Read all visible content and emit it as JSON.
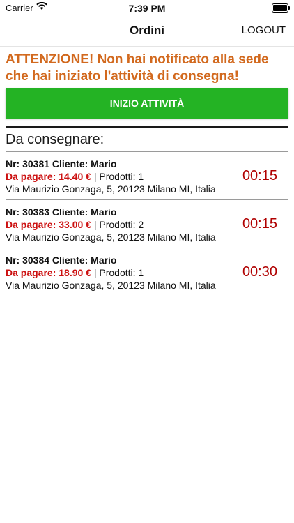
{
  "status_bar": {
    "carrier": "Carrier",
    "time": "7:39 PM"
  },
  "nav": {
    "title": "Ordini",
    "logout_label": "LOGOUT"
  },
  "warning": {
    "text": "ATTENZIONE! Non hai notificato alla sede che hai iniziato l'attività di consegna!",
    "color": "#d2691e"
  },
  "start_button": {
    "label": "INIZIO ATTIVITÀ",
    "color": "#24b324"
  },
  "section": {
    "title": "Da consegnare:"
  },
  "orders": [
    {
      "header": "Nr: 30381 Cliente: Mario",
      "pay_label": "Da pagare: 14.40 €",
      "products": " | Prodotti: 1",
      "address": "Via Maurizio Gonzaga, 5, 20123 Milano MI, Italia",
      "timer": "00:15"
    },
    {
      "header": "Nr: 30383 Cliente: Mario",
      "pay_label": "Da pagare: 33.00 €",
      "products": " | Prodotti: 2",
      "address": "Via Maurizio Gonzaga, 5, 20123 Milano MI, Italia",
      "timer": "00:15"
    },
    {
      "header": "Nr: 30384 Cliente: Mario",
      "pay_label": "Da pagare: 18.90 €",
      "products": " | Prodotti: 1",
      "address": "Via Maurizio Gonzaga, 5, 20123 Milano MI, Italia",
      "timer": "00:30"
    }
  ],
  "icons": {
    "wifi": "wifi-icon",
    "battery": "battery-icon"
  }
}
